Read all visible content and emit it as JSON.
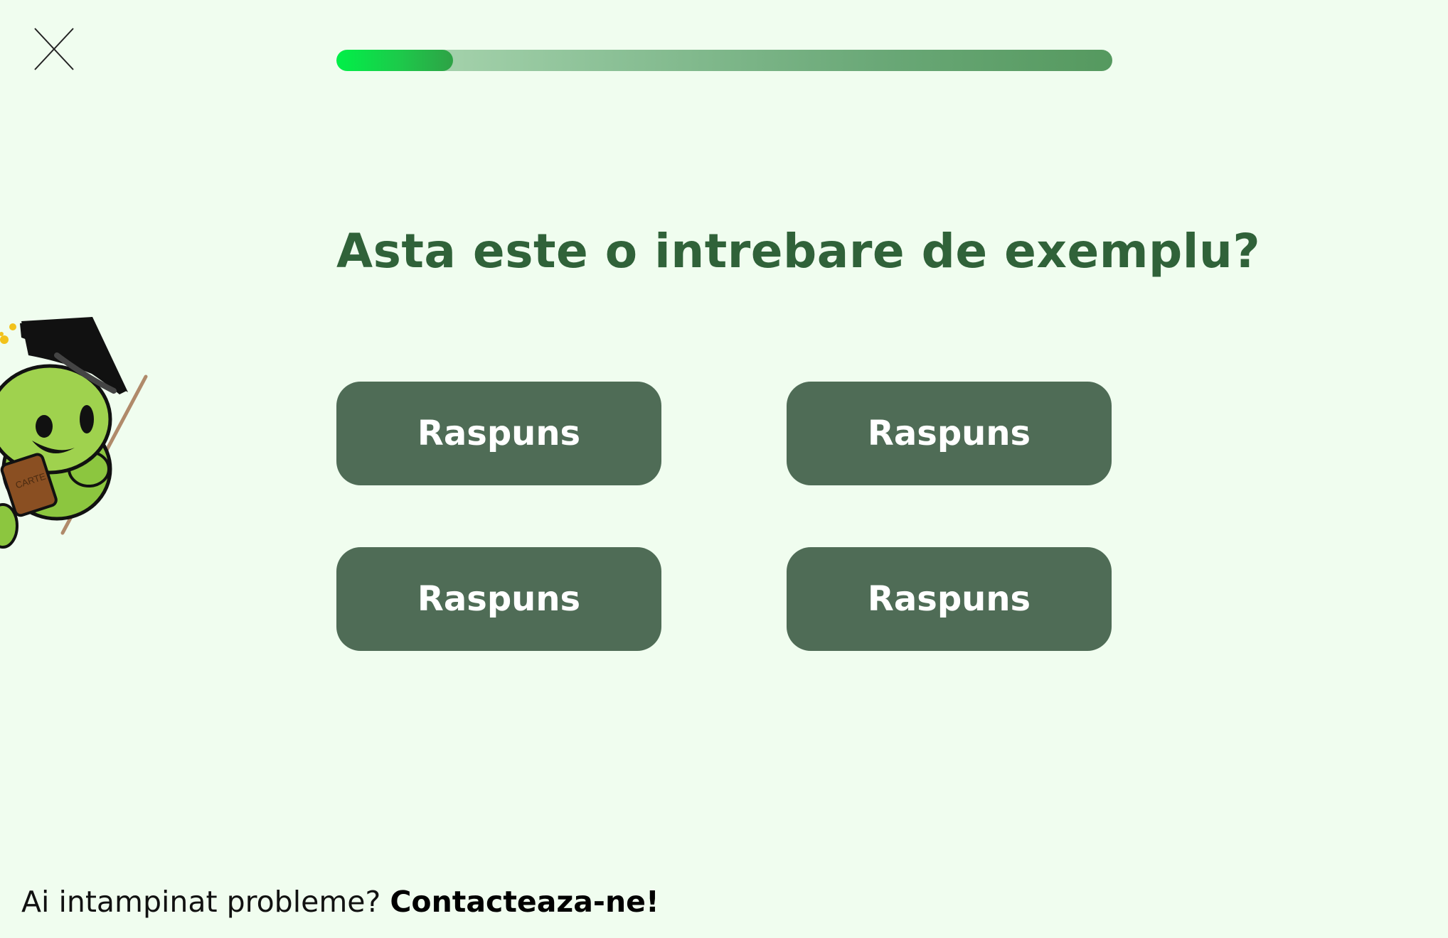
{
  "quiz": {
    "progress_fraction": 0.15,
    "question": "Asta este o intrebare de exemplu?",
    "answers": [
      "Raspuns",
      "Raspuns",
      "Raspuns",
      "Raspuns"
    ]
  },
  "mascot": {
    "book_text": "CARTE"
  },
  "footer": {
    "prompt": "Ai intampinat probleme?",
    "contact_link": "Contacteaza-ne!"
  },
  "icons": {
    "close": "close-icon",
    "mascot": "graduate-mascot-icon"
  },
  "colors": {
    "background": "#f0fdef",
    "primary_dark": "#306239",
    "button": "#4f6c56",
    "progress_fill": "#00f048"
  }
}
